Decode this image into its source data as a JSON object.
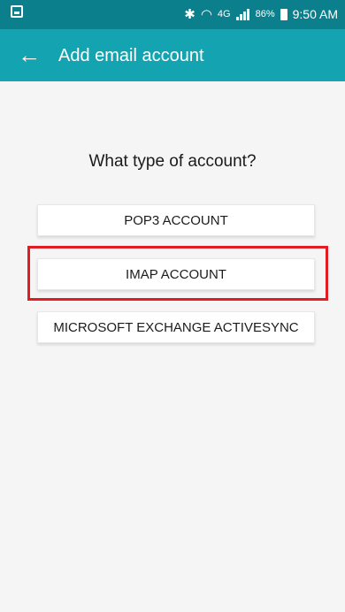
{
  "status_bar": {
    "signal_label": "4G",
    "battery": "86%",
    "time": "9:50 AM"
  },
  "header": {
    "title": "Add email account"
  },
  "prompt": {
    "title": "What type of account?"
  },
  "account_types": [
    {
      "label": "POP3 ACCOUNT"
    },
    {
      "label": "IMAP ACCOUNT"
    },
    {
      "label": "MICROSOFT EXCHANGE ACTIVESYNC"
    }
  ],
  "colors": {
    "status_bar": "#0b7f8c",
    "header": "#13a3b1",
    "highlight": "#e31b23",
    "background": "#f5f5f5"
  },
  "icons": {
    "status_left": "notification-icon",
    "bluetooth": "bluetooth-icon",
    "wifi": "wifi-icon",
    "signal": "signal-icon",
    "battery": "battery-icon",
    "back": "arrow-left-icon"
  }
}
